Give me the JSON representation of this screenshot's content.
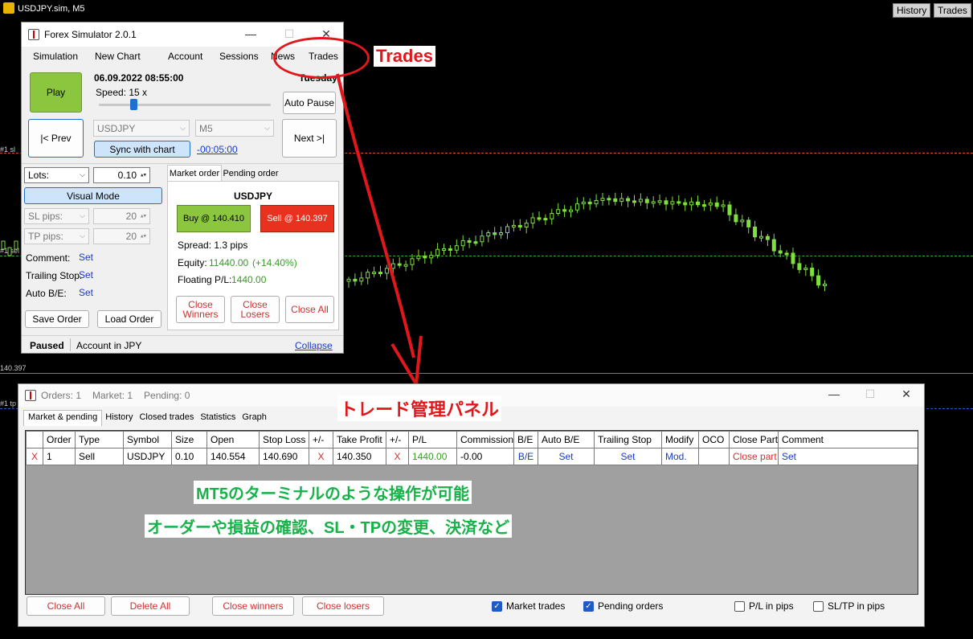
{
  "chart": {
    "title": "USDJPY.sim, M5",
    "top_tabs": [
      "History",
      "Trades"
    ],
    "side_labels": [
      "#1 sl",
      "#1 sel",
      "140.397",
      "#1 tp"
    ]
  },
  "simulator": {
    "title": "Forex Simulator 2.0.1",
    "menu": [
      "Simulation",
      "New Chart",
      "Account",
      "Sessions",
      "News",
      "Trades"
    ],
    "play_label": "Play",
    "datetime": "06.09.2022 08:55:00",
    "weekday": "Tuesday",
    "speed_label": "Speed: 15 x",
    "speed_fraction": 0.2,
    "auto_pause_label": "Auto Pause",
    "prev_label": "|< Prev",
    "next_label": "Next >|",
    "symbol": "USDJPY",
    "timeframe": "M5",
    "sync_label": "Sync with chart",
    "time_offset": "-00:05:00",
    "lots_label": "Lots:",
    "lots_value": "0.10",
    "visual_mode_label": "Visual Mode",
    "sl_label": "SL pips:",
    "sl_value": "20",
    "tp_label": "TP pips:",
    "tp_value": "20",
    "comment_label": "Comment:",
    "trailing_label": "Trailing Stop:",
    "autobe_label": "Auto B/E:",
    "set_label": "Set",
    "save_order_label": "Save Order",
    "load_order_label": "Load Order",
    "tab_market": "Market order",
    "tab_pending": "Pending order",
    "order_symbol": "USDJPY",
    "buy_label": "Buy @ 140.410",
    "sell_label": "Sell @ 140.397",
    "spread": "Spread: 1.3 pips",
    "equity_label": "Equity:",
    "equity_value": "11440.00",
    "equity_pct": "(+14.40%)",
    "floating_label": "Floating P/L:",
    "floating_value": "1440.00",
    "close_winners_1": "Close",
    "close_winners_2": "Winners",
    "close_losers_1": "Close",
    "close_losers_2": "Losers",
    "close_all_label": "Close All",
    "status": "Paused",
    "account_currency": "Account in JPY",
    "collapse_label": "Collapse"
  },
  "orders_window": {
    "title_orders": "Orders: 1",
    "title_market": "Market: 1",
    "title_pending": "Pending: 0",
    "tabs": [
      "Market & pending",
      "History",
      "Closed trades",
      "Statistics",
      "Graph"
    ],
    "columns": [
      "",
      "Order",
      "Type",
      "Symbol",
      "Size",
      "Open",
      "Stop Loss",
      "+/-",
      "Take Profit",
      "+/-",
      "P/L",
      "Commission",
      "B/E",
      "Auto B/E",
      "Trailing Stop",
      "Modify",
      "OCO",
      "Close Part",
      "Comment"
    ],
    "rows": [
      [
        "X",
        "1",
        "Sell",
        "USDJPY",
        "0.10",
        "140.554",
        "140.690",
        "X",
        "140.350",
        "X",
        "1440.00",
        "-0.00",
        "B/E",
        "Set",
        "Set",
        "Mod.",
        "",
        "Close part",
        "Set"
      ]
    ],
    "buttons": [
      "Close All",
      "Delete All",
      "Close winners",
      "Close losers"
    ],
    "checkboxes": [
      {
        "label": "Market trades",
        "checked": true
      },
      {
        "label": "Pending orders",
        "checked": true
      },
      {
        "label": "P/L in pips",
        "checked": false
      },
      {
        "label": "SL/TP in pips",
        "checked": false
      }
    ]
  },
  "annotations": {
    "trades_label": "Trades",
    "panel_label": "トレード管理パネル",
    "line1": "MT5のターミナルのような操作が可能",
    "line2": "オーダーや損益の確認、SL・TPの変更、決済など"
  },
  "colors": {
    "buy": "#8cc63f",
    "sell": "#e8321f",
    "candle": "#7ee03a",
    "annot_red": "#e0181c",
    "annot_green": "#19b24a"
  }
}
